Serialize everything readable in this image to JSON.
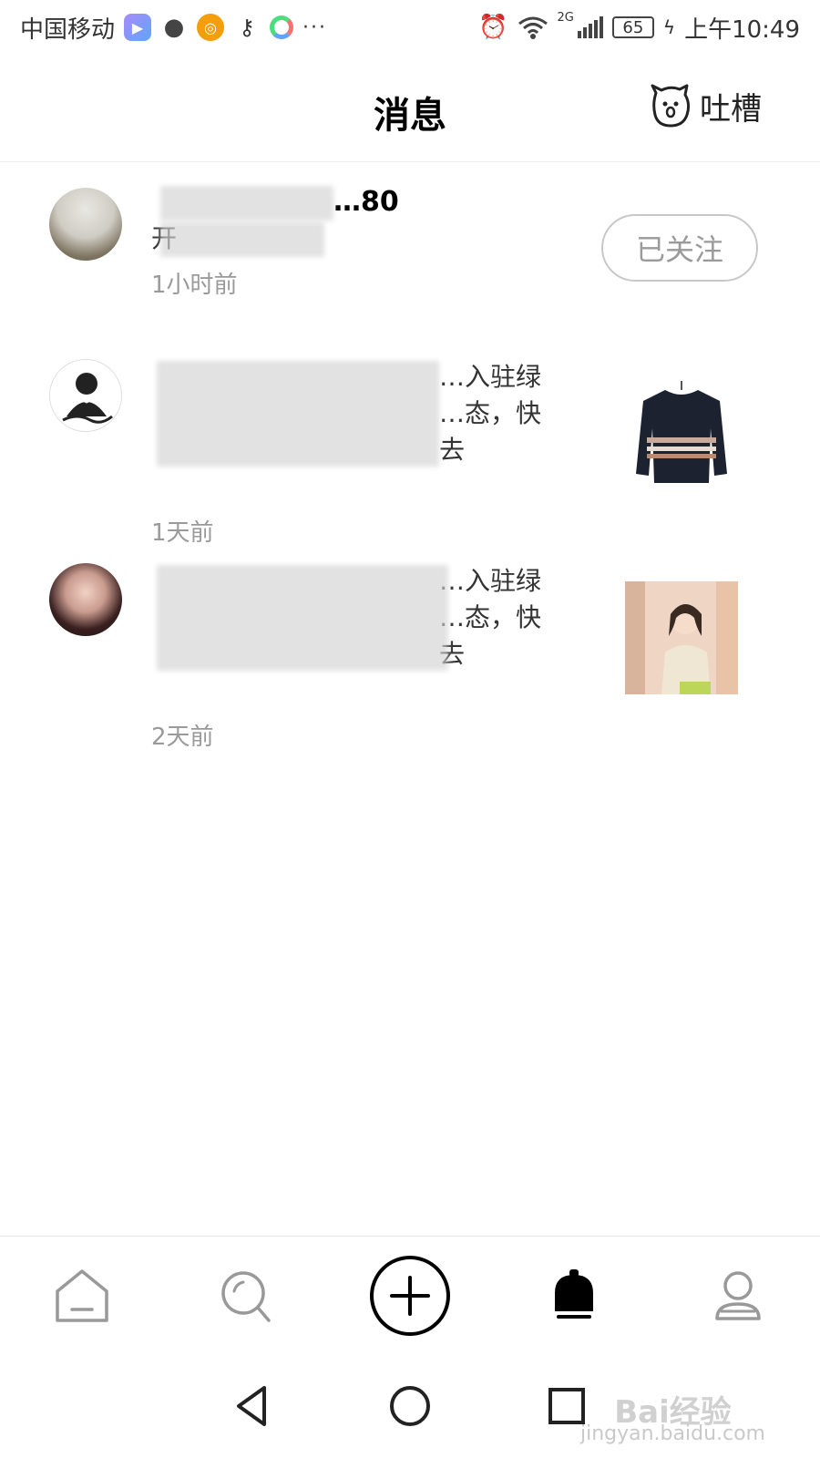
{
  "status_bar": {
    "carrier": "中国移动",
    "more": "···",
    "network": "2G",
    "battery": "65",
    "time": "上午10:49"
  },
  "header": {
    "title": "消息",
    "tucao_label": "吐槽"
  },
  "messages": [
    {
      "name": "…80",
      "text": "开",
      "time": "1小时前",
      "action_label": "已关注"
    },
    {
      "text_line1": "…入驻绿",
      "text_line2": "…态，快去",
      "text_line3": "",
      "time": "1天前"
    },
    {
      "text_line1": "…入驻绿",
      "text_line2": "…态，快去",
      "text_line3": "",
      "time": "2天前"
    }
  ],
  "bottom_nav": {
    "items": [
      "home-icon",
      "search-icon",
      "add-icon",
      "notification-bell-icon",
      "profile-icon"
    ],
    "active": "notification-bell-icon"
  },
  "watermark": {
    "brand": "Bai经验",
    "url": "jingyan.baidu.com"
  }
}
